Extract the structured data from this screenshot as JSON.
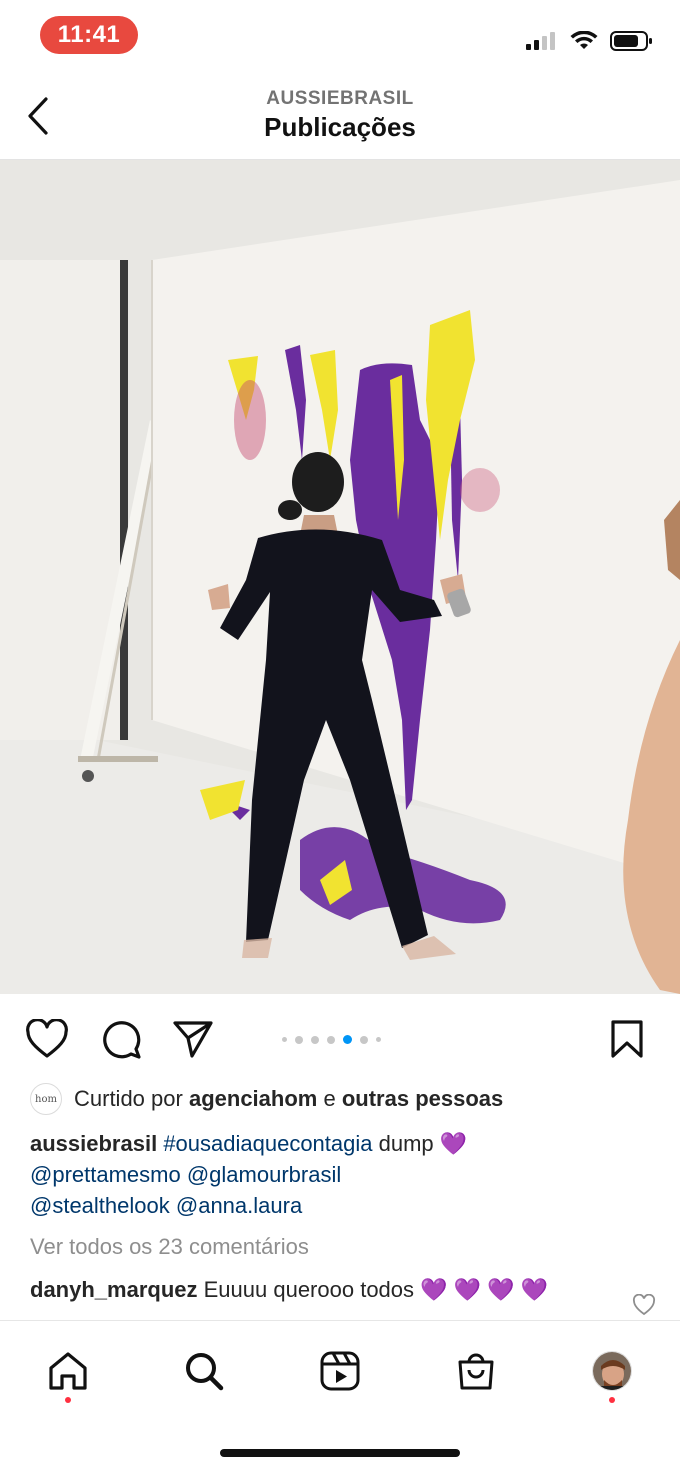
{
  "status_bar": {
    "time": "11:41"
  },
  "header": {
    "account": "AUSSIEBRASIL",
    "title": "Publicações"
  },
  "carousel": {
    "count": 6,
    "active_index": 4
  },
  "likes": {
    "avatar_text": "hom",
    "prefix": "Curtido por",
    "user": "agenciahom",
    "joiner": "e",
    "others": "outras pessoas"
  },
  "caption": {
    "username": "aussiebrasil",
    "hashtag": "#ousadiaqueconta gia",
    "hashtag_exact": "#ousadiaquecontagia",
    "text": "dump",
    "emoji": "💜",
    "mentions": [
      "@prettamesmo",
      "@glamourbrasil",
      "@stealthelook",
      "@anna.laura"
    ]
  },
  "view_comments": "Ver todos os 23 comentários",
  "comment": {
    "username": "danyh_marquez",
    "text": "Euuuu querooo todos",
    "emojis": "💜 💜 💜 💜"
  },
  "nav": {
    "items": [
      "home-icon",
      "search-icon",
      "reels-icon",
      "shop-icon",
      "profile-avatar"
    ]
  },
  "colors": {
    "link": "#00376b",
    "muted": "#8e8e8e",
    "notification": "#ff3040",
    "time_pill": "#e8493f",
    "carousel_active": "#0095f6",
    "purple_paint": "#6a2d9e",
    "yellow_paint": "#f1e330"
  }
}
